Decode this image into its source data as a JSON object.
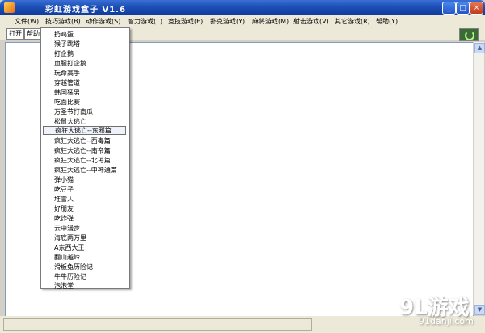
{
  "window": {
    "title": "彩虹游戏盒子 V1.6",
    "buttons": {
      "minimize": "_",
      "maximize": "□",
      "close": "×"
    }
  },
  "menu": [
    {
      "label": "文件(W)"
    },
    {
      "label": "技巧游戏(B)"
    },
    {
      "label": "动作游戏(S)"
    },
    {
      "label": "智力游戏(T)"
    },
    {
      "label": "竞技游戏(E)"
    },
    {
      "label": "扑克游戏(Y)"
    },
    {
      "label": "麻将游戏(M)"
    },
    {
      "label": "射击游戏(V)"
    },
    {
      "label": "其它游戏(R)"
    },
    {
      "label": "帮助(Y)"
    }
  ],
  "toolbar": {
    "open_label": "打开",
    "help_label": "帮助"
  },
  "dropdown": {
    "selected_index": 11,
    "items": [
      "扔鸡蛋",
      "猴子跳塔",
      "打企鹅",
      "血腥打企鹅",
      "玩命高手",
      "穿越管道",
      "韩国猛男",
      "吃面比赛",
      "万圣节打南瓜",
      "松鼠大逃亡",
      "疯狂大逃亡--东邪篇",
      "疯狂大逃亡--西毒篇",
      "疯狂大逃亡--南帝篇",
      "疯狂大逃亡--北丐篇",
      "疯狂大逃亡--中神通篇",
      "弹小猫",
      "吃豆子",
      "堆雪人",
      "好朋友",
      "吃炸弹",
      "云中漫步",
      "海底两万里",
      "A东西大王",
      "翻山越岭",
      "滑板兔历险记",
      "牛牛历险记",
      "泡泡堂"
    ]
  },
  "watermark": {
    "logo": "9L游戏",
    "url": "91danji.com"
  }
}
